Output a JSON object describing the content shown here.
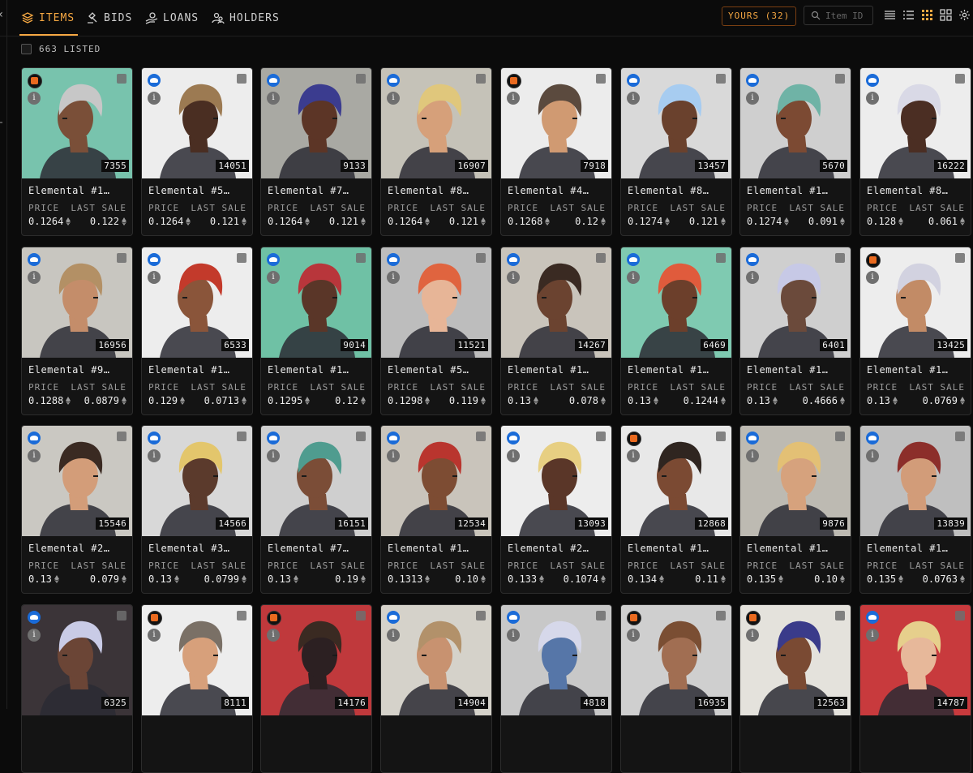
{
  "nav": {
    "tabs": [
      {
        "label": "ITEMS",
        "active": true,
        "icon": "layers-icon"
      },
      {
        "label": "BIDS",
        "active": false,
        "icon": "gavel-icon"
      },
      {
        "label": "LOANS",
        "active": false,
        "icon": "coin-hand-icon"
      },
      {
        "label": "HOLDERS",
        "active": false,
        "icon": "users-icon"
      }
    ],
    "yours_label": "YOURS (32)",
    "search_placeholder": "Item ID",
    "view_icons": [
      "list-dense-icon",
      "list-icon",
      "grid-small-icon",
      "grid-large-icon",
      "gear-icon"
    ]
  },
  "listing": {
    "count_label": "663 LISTED"
  },
  "colors": {
    "accent": "#f5a742",
    "card_bg": "#141414",
    "blue_badge": "#1a6bd8",
    "orange_badge": "#ea6a1f"
  },
  "labels": {
    "price": "PRICE",
    "last_sale": "LAST SALE"
  },
  "items": [
    {
      "name": "Elemental #1…",
      "id": "7355",
      "price": "0.1264",
      "last": "0.122",
      "badge": "orange",
      "bg": "#78c3ad",
      "hair": "#c7c7c7",
      "skin": "#7a4f38"
    },
    {
      "name": "Elemental #5…",
      "id": "14051",
      "price": "0.1264",
      "last": "0.121",
      "badge": "blue",
      "bg": "#ededed",
      "hair": "#9c7a52",
      "skin": "#4a2e22"
    },
    {
      "name": "Elemental #7…",
      "id": "9133",
      "price": "0.1264",
      "last": "0.121",
      "badge": "blue",
      "bg": "#a9a9a3",
      "hair": "#3b3c8f",
      "skin": "#5c3526"
    },
    {
      "name": "Elemental #8…",
      "id": "16907",
      "price": "0.1264",
      "last": "0.121",
      "badge": "blue",
      "bg": "#c5c2b8",
      "hair": "#e0c77c",
      "skin": "#d6a07a"
    },
    {
      "name": "Elemental #4…",
      "id": "7918",
      "price": "0.1268",
      "last": "0.12",
      "badge": "orange",
      "bg": "#ececec",
      "hair": "#5b4a3e",
      "skin": "#d09a72"
    },
    {
      "name": "Elemental #8…",
      "id": "13457",
      "price": "0.1274",
      "last": "0.121",
      "badge": "blue",
      "bg": "#d9d9d9",
      "hair": "#a7ccf0",
      "skin": "#6a412d"
    },
    {
      "name": "Elemental #1…",
      "id": "5670",
      "price": "0.1274",
      "last": "0.091",
      "badge": "blue",
      "bg": "#cfcfcf",
      "hair": "#6fb3a6",
      "skin": "#7c4a33"
    },
    {
      "name": "Elemental #8…",
      "id": "16222",
      "price": "0.128",
      "last": "0.061",
      "badge": "blue",
      "bg": "#ededed",
      "hair": "#d9d9e6",
      "skin": "#4b2e23"
    },
    {
      "name": "Elemental #9…",
      "id": "16956",
      "price": "0.1288",
      "last": "0.0879",
      "badge": "blue",
      "bg": "#c8c6c0",
      "hair": "#b39065",
      "skin": "#c48d6a"
    },
    {
      "name": "Elemental #1…",
      "id": "6533",
      "price": "0.129",
      "last": "0.0713",
      "badge": "blue",
      "bg": "#ededed",
      "hair": "#c33a2b",
      "skin": "#8a553a"
    },
    {
      "name": "Elemental #1…",
      "id": "9014",
      "price": "0.1295",
      "last": "0.12",
      "badge": "blue",
      "bg": "#6fc1a5",
      "hair": "#b8363b",
      "skin": "#5a3628"
    },
    {
      "name": "Elemental #5…",
      "id": "11521",
      "price": "0.1298",
      "last": "0.119",
      "badge": "blue",
      "bg": "#bdbdbd",
      "hair": "#e0643f",
      "skin": "#e7b597"
    },
    {
      "name": "Elemental #1…",
      "id": "14267",
      "price": "0.13",
      "last": "0.078",
      "badge": "blue",
      "bg": "#c9c4bb",
      "hair": "#3a2a22",
      "skin": "#6b4330"
    },
    {
      "name": "Elemental #1…",
      "id": "6469",
      "price": "0.13",
      "last": "0.1244",
      "badge": "blue",
      "bg": "#7fcab1",
      "hair": "#e05b3c",
      "skin": "#6c3f2b"
    },
    {
      "name": "Elemental #1…",
      "id": "6401",
      "price": "0.13",
      "last": "0.4666",
      "badge": "blue",
      "bg": "#cfcfcf",
      "hair": "#c7c9e6",
      "skin": "#6b4a3b"
    },
    {
      "name": "Elemental #1…",
      "id": "13425",
      "price": "0.13",
      "last": "0.0769",
      "badge": "orange",
      "bg": "#ededed",
      "hair": "#d2d2e0",
      "skin": "#c28b66"
    },
    {
      "name": "Elemental #2…",
      "id": "15546",
      "price": "0.13",
      "last": "0.079",
      "badge": "blue",
      "bg": "#cac8c2",
      "hair": "#3a2a22",
      "skin": "#d39d79"
    },
    {
      "name": "Elemental #3…",
      "id": "14566",
      "price": "0.13",
      "last": "0.0799",
      "badge": "blue",
      "bg": "#d8d8d8",
      "hair": "#e3c66c",
      "skin": "#5b3a2c"
    },
    {
      "name": "Elemental #7…",
      "id": "16151",
      "price": "0.13",
      "last": "0.19",
      "badge": "blue",
      "bg": "#cfcfcf",
      "hair": "#4f9c8f",
      "skin": "#7b4d37"
    },
    {
      "name": "Elemental #1…",
      "id": "12534",
      "price": "0.1313",
      "last": "0.10",
      "badge": "blue",
      "bg": "#c9c4bb",
      "hair": "#b9352e",
      "skin": "#7d4c33"
    },
    {
      "name": "Elemental #2…",
      "id": "13093",
      "price": "0.133",
      "last": "0.1074",
      "badge": "blue",
      "bg": "#ededed",
      "hair": "#e7cf82",
      "skin": "#5a3628"
    },
    {
      "name": "Elemental #1…",
      "id": "12868",
      "price": "0.134",
      "last": "0.11",
      "badge": "orange",
      "bg": "#e8e8e8",
      "hair": "#2f2520",
      "skin": "#7b4a33"
    },
    {
      "name": "Elemental #1…",
      "id": "9876",
      "price": "0.135",
      "last": "0.10",
      "badge": "blue",
      "bg": "#bdbab2",
      "hair": "#e3c075",
      "skin": "#d6a27d"
    },
    {
      "name": "Elemental #1…",
      "id": "13839",
      "price": "0.135",
      "last": "0.0763",
      "badge": "blue",
      "bg": "#bfbfbf",
      "hair": "#8c2e2a",
      "skin": "#d29c79"
    },
    {
      "id": "6325",
      "badge": "blue",
      "bg": "#3b3438",
      "hair": "#c9cbe6",
      "skin": "#6b4536"
    },
    {
      "id": "8111",
      "badge": "orange",
      "bg": "#ededed",
      "hair": "#7a7066",
      "skin": "#d7a07b"
    },
    {
      "id": "14176",
      "badge": "orange",
      "bg": "#c0393c",
      "hair": "#3a2a22",
      "skin": "#2c2022"
    },
    {
      "id": "14904",
      "badge": "blue",
      "bg": "#d5d2ca",
      "hair": "#b2916a",
      "skin": "#c89270"
    },
    {
      "id": "4818",
      "badge": "blue",
      "bg": "#c8c8c8",
      "hair": "#d6d8ea",
      "skin": "#5676a8"
    },
    {
      "id": "16935",
      "badge": "orange",
      "bg": "#cfcfcf",
      "hair": "#7a4e33",
      "skin": "#a16e52"
    },
    {
      "id": "12563",
      "badge": "orange",
      "bg": "#e4e2dc",
      "hair": "#3a3b8a",
      "skin": "#7a4a33"
    },
    {
      "id": "14787",
      "badge": "blue",
      "bg": "#c83a3d",
      "hair": "#e6cf8c",
      "skin": "#e7b89a"
    }
  ]
}
